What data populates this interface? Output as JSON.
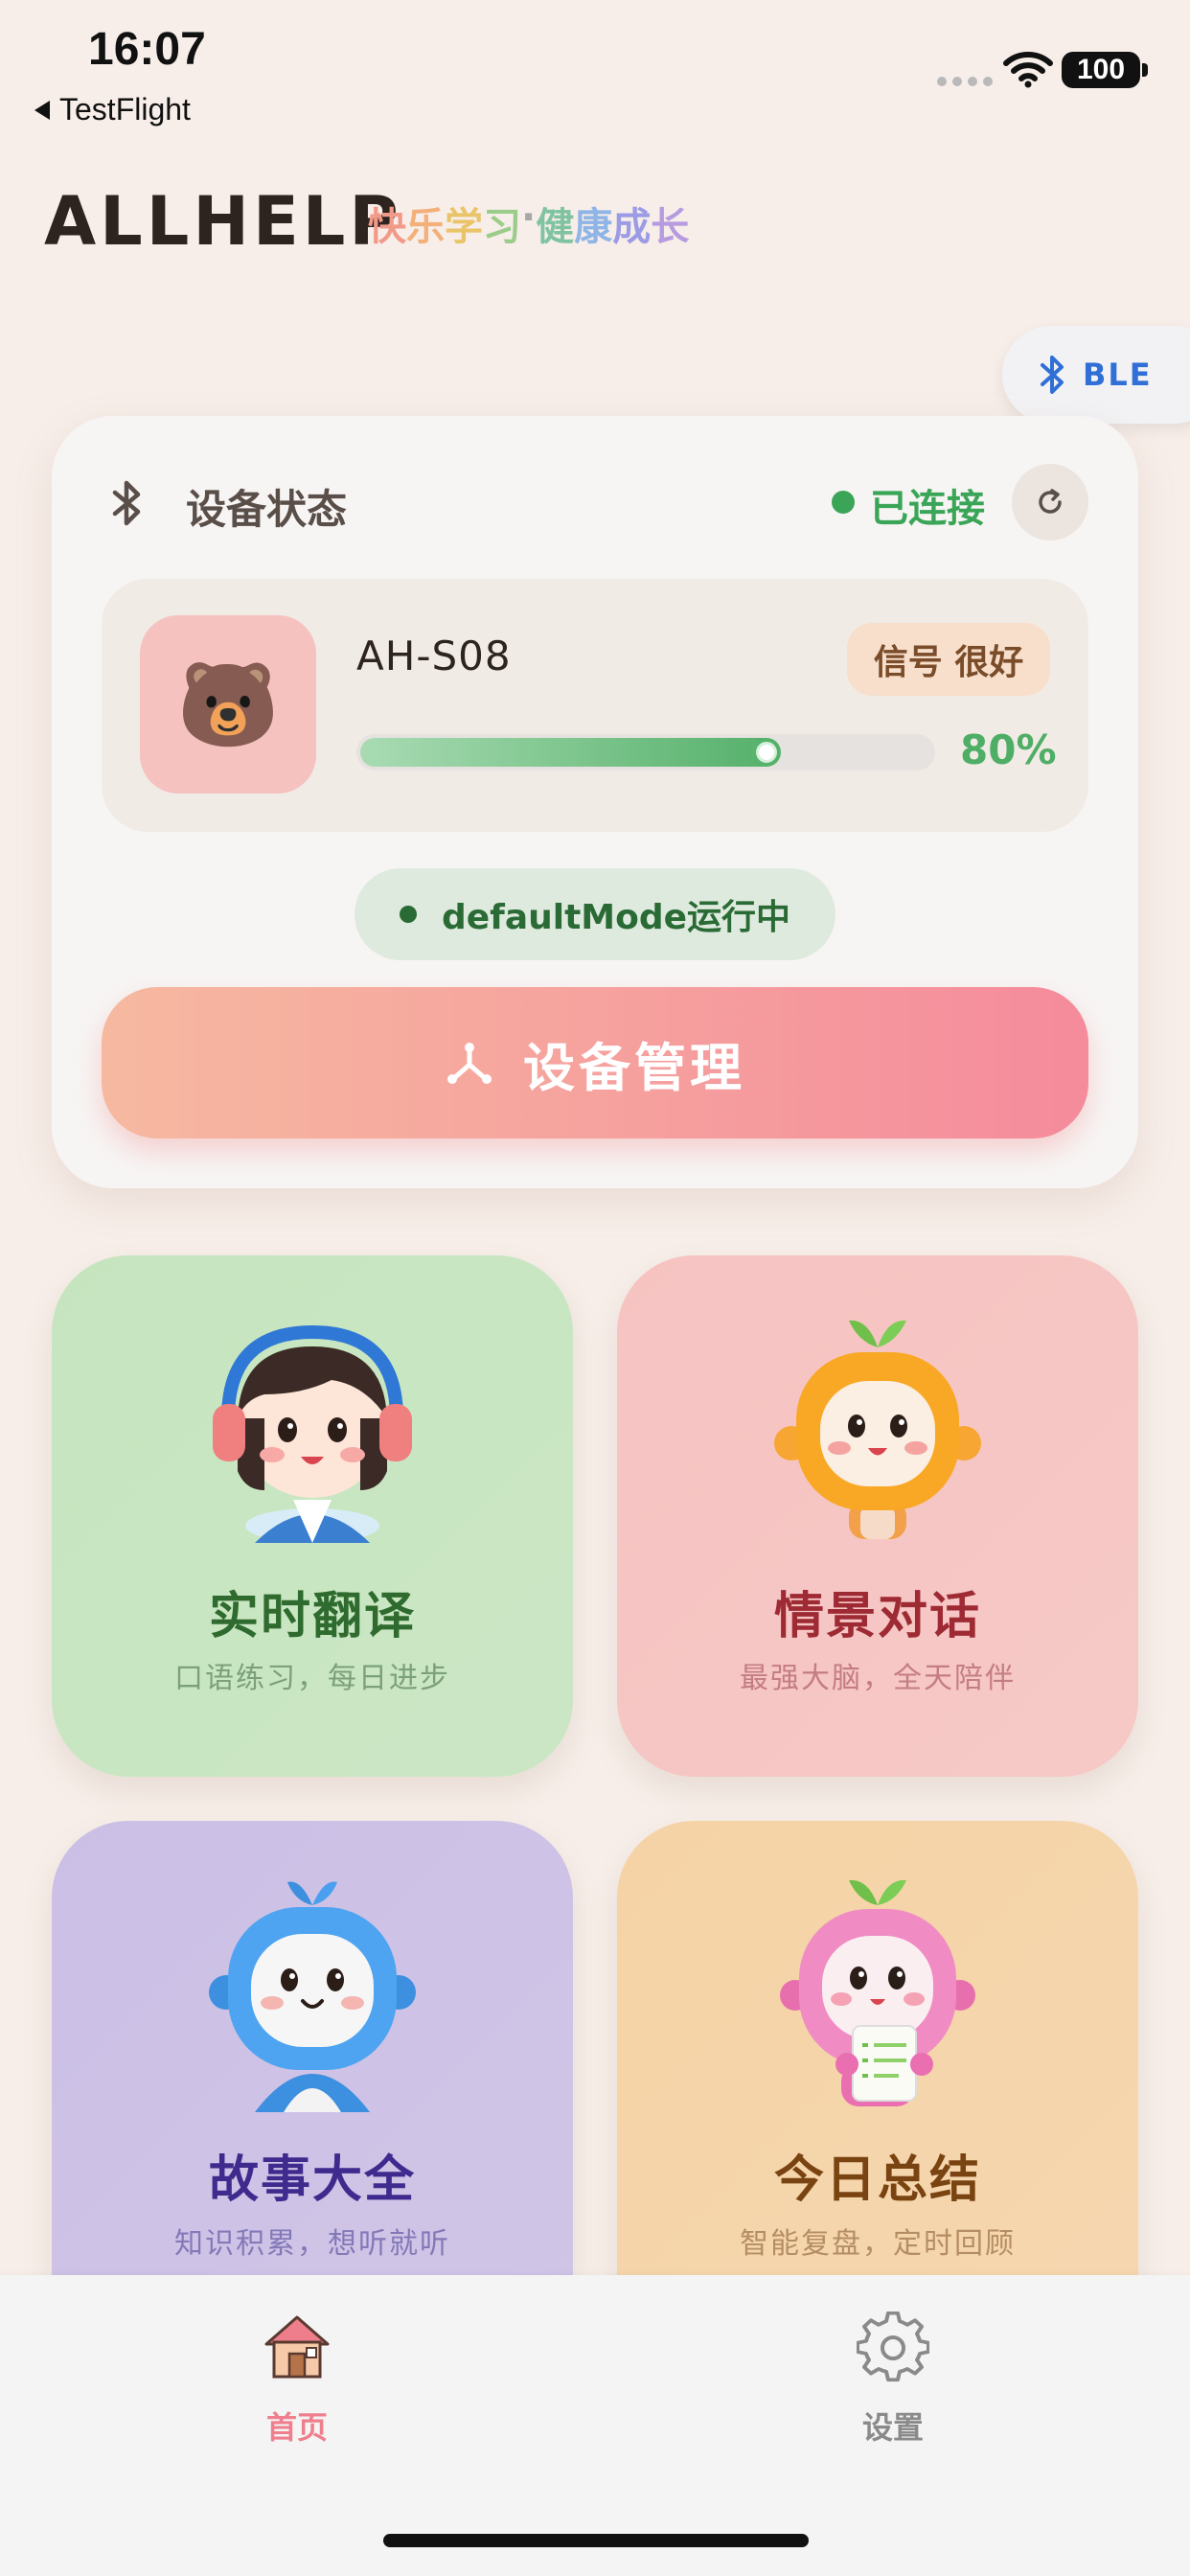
{
  "status_bar": {
    "time": "16:07",
    "back_app": "TestFlight",
    "battery": "100"
  },
  "header": {
    "brand": "ALLHELP",
    "slogan": [
      "快",
      "乐",
      "学",
      "习",
      "·",
      "健",
      "康",
      "成",
      "长"
    ],
    "slogan_colors": [
      "#f29a8a",
      "#f3b07a",
      "#e9c46a",
      "#9ccc8a",
      "#a8a8a8",
      "#7fc3a0",
      "#8fb4e6",
      "#9b9be6",
      "#b79be0"
    ]
  },
  "ble_button": {
    "label": "BLE",
    "icon": "bluetooth-icon"
  },
  "device_status": {
    "title": "设备状态",
    "connection": "已连接",
    "device_name": "AH-S08",
    "avatar_emoji": "🐻",
    "signal": "信号 很好",
    "battery_percent_text": "80%",
    "battery_level": 0.8,
    "mode": "defaultMode运行中",
    "manage_label": "设备管理",
    "colors": {
      "connected": "#3aa557",
      "battery": "#4fae66",
      "accent": "#f58b9c"
    }
  },
  "features": [
    {
      "title": "实时翻译",
      "subtitle": "口语练习，每日进步",
      "title_color": "#2f6b2f",
      "sub_color": "#7ba07a",
      "bg": "#c5e5bf"
    },
    {
      "title": "情景对话",
      "subtitle": "最强大脑，全天陪伴",
      "title_color": "#9e2a34",
      "sub_color": "#c47d82",
      "bg": "#f6c3c1"
    },
    {
      "title": "故事大全",
      "subtitle": "知识积累，想听就听",
      "title_color": "#3f2a8e",
      "sub_color": "#8479b8",
      "bg": "#cbbfe6"
    },
    {
      "title": "今日总结",
      "subtitle": "智能复盘，定时回顾",
      "title_color": "#7a4412",
      "sub_color": "#b58d64",
      "bg": "#f5d3a6"
    }
  ],
  "tabbar": {
    "home": {
      "label": "首页",
      "icon": "house-icon",
      "color": "#f07f8e"
    },
    "settings": {
      "label": "设置",
      "icon": "gear-icon",
      "color": "#8a8a8a"
    }
  }
}
